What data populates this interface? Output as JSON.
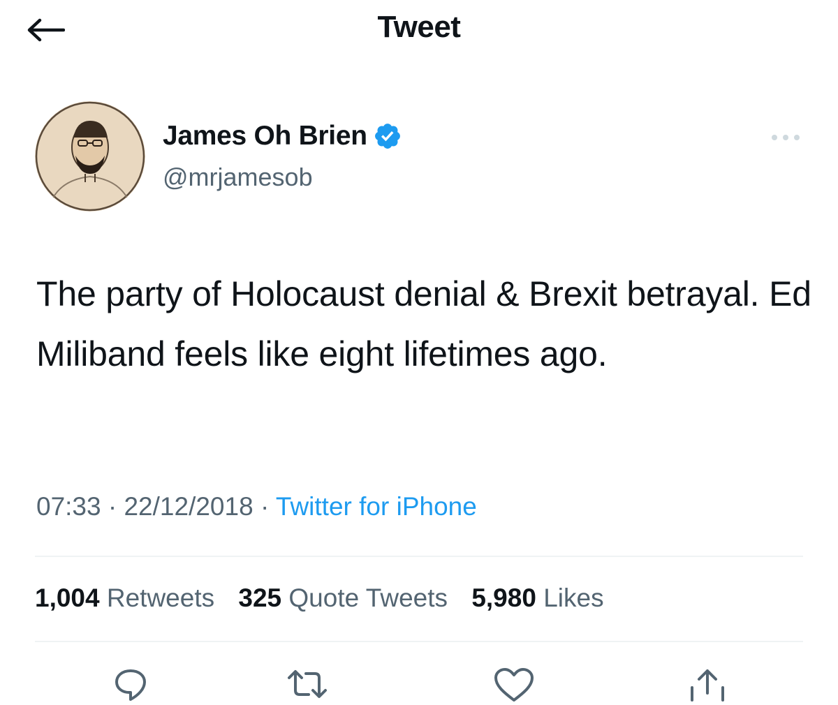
{
  "header": {
    "title": "Tweet",
    "back_icon": "arrow-left-icon"
  },
  "author": {
    "display_name": "James Oh Brien",
    "handle": "@mrjamesob",
    "verified": true,
    "verified_icon": "verified-badge-icon"
  },
  "tweet": {
    "text": "The party of Holocaust denial & Brexit betrayal. Ed Miliband feels like eight lifetimes ago.",
    "time": "07:33",
    "date": "22/12/2018",
    "separator": "·",
    "source": "Twitter for iPhone"
  },
  "stats": {
    "retweets_count": "1,004",
    "retweets_label": "Retweets",
    "quotes_count": "325",
    "quotes_label": "Quote Tweets",
    "likes_count": "5,980",
    "likes_label": "Likes"
  },
  "actions": [
    "reply-icon",
    "retweet-icon",
    "like-icon",
    "share-icon"
  ],
  "colors": {
    "accent": "#1d9bf0",
    "text": "#0f1419",
    "secondary": "#536471",
    "divider": "#eff3f4"
  }
}
